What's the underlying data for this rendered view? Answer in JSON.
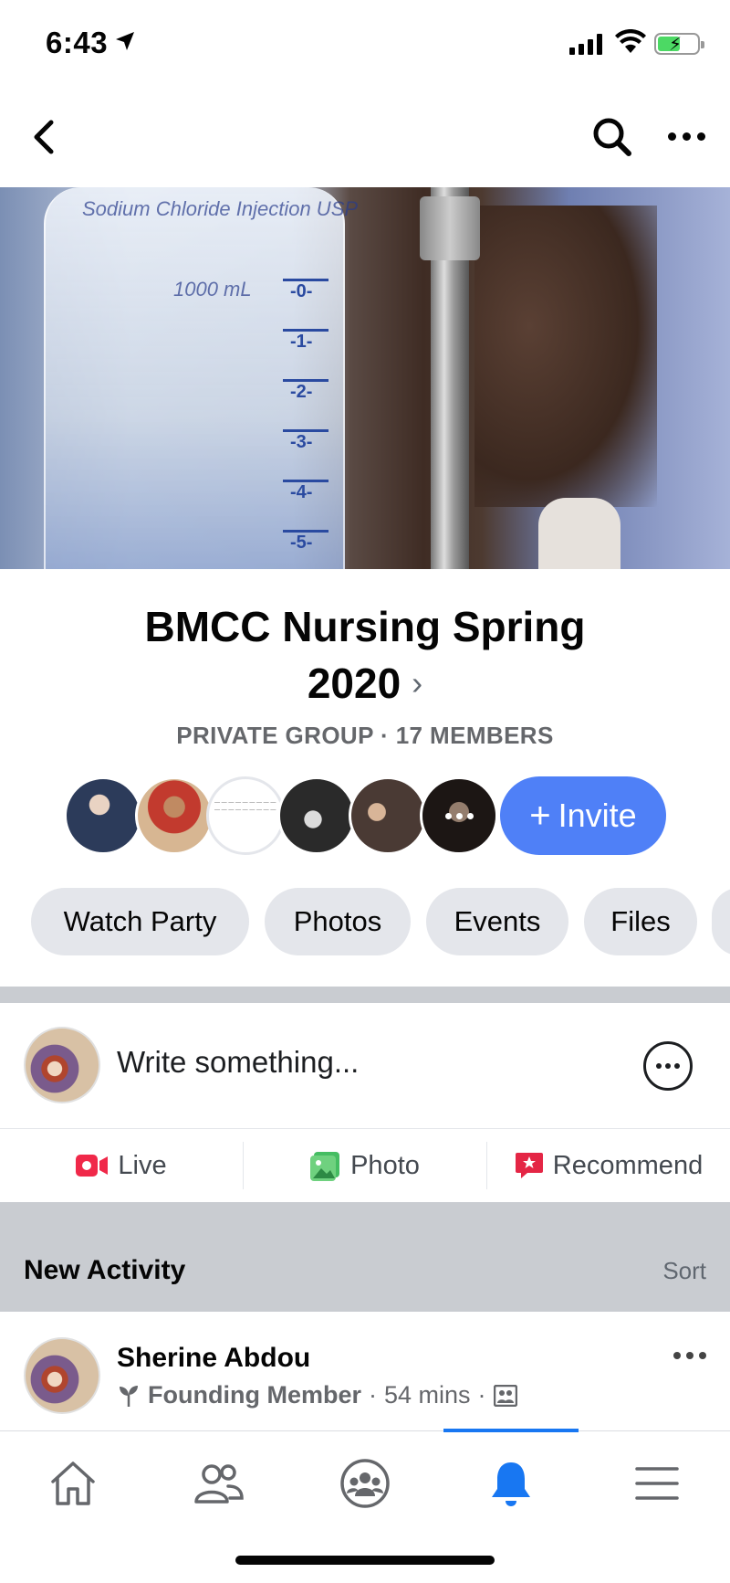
{
  "status_bar": {
    "time": "6:43"
  },
  "group": {
    "title_line1": "BMCC Nursing Spring",
    "title_line2": "2020",
    "meta": "PRIVATE GROUP · 17 MEMBERS",
    "invite_label": "Invite",
    "member_avatar_count_shown": 6
  },
  "cover": {
    "bag_text": "Sodium Chloride Injection USP",
    "bag_volume": "1000 mL",
    "scale_marks": [
      "-0-",
      "-1-",
      "-2-",
      "-3-",
      "-4-",
      "-5-"
    ]
  },
  "chips": [
    "Watch Party",
    "Photos",
    "Events",
    "Files"
  ],
  "composer": {
    "placeholder": "Write something..."
  },
  "actions": [
    {
      "label": "Live",
      "icon": "live-video-icon",
      "color": "#f02849"
    },
    {
      "label": "Photo",
      "icon": "photo-icon",
      "color": "#45bd62"
    },
    {
      "label": "Recommend",
      "icon": "recommend-icon",
      "color": "#e42645"
    }
  ],
  "activity": {
    "title": "New Activity",
    "sort_label": "Sort"
  },
  "post": {
    "author": "Sherine Abdou",
    "badge": "Founding Member",
    "time": "54 mins"
  },
  "tabs": [
    {
      "name": "home",
      "icon": "home-icon",
      "active": false
    },
    {
      "name": "friends",
      "icon": "friends-icon",
      "active": false
    },
    {
      "name": "groups",
      "icon": "groups-icon",
      "active": false
    },
    {
      "name": "notifications",
      "icon": "bell-icon",
      "active": true
    },
    {
      "name": "menu",
      "icon": "menu-icon",
      "active": false
    }
  ],
  "colors": {
    "accent": "#1877f2",
    "invite_button": "#4f80f7",
    "chip_bg": "#e4e6eb",
    "section_bg": "#c9ccd1"
  }
}
